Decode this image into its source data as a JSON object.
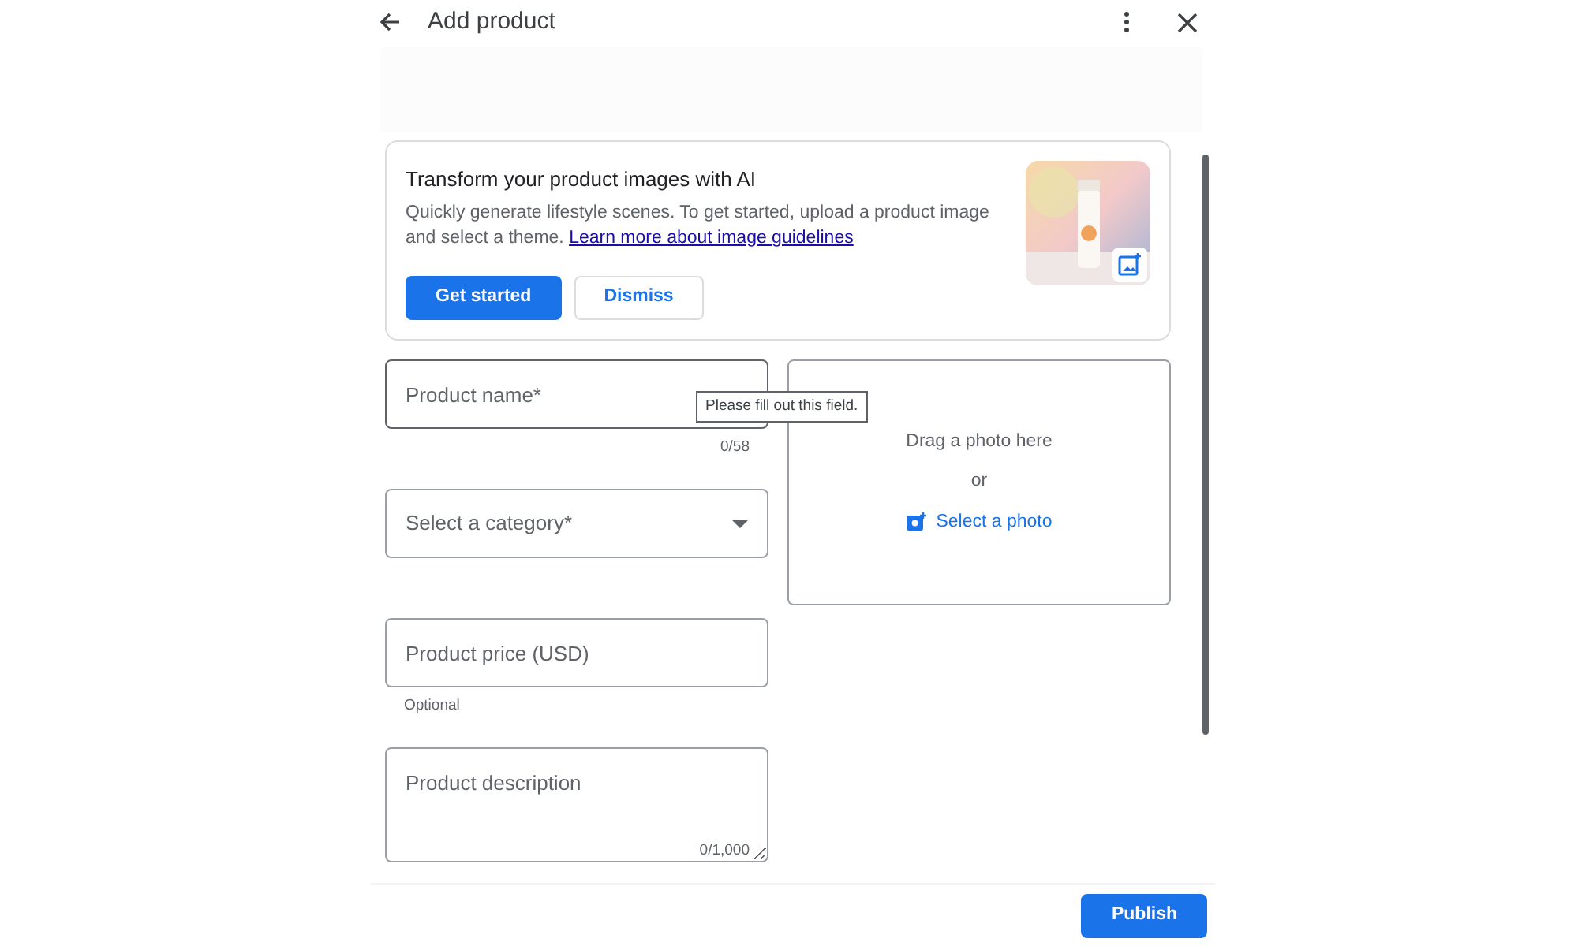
{
  "header": {
    "title": "Add product"
  },
  "banner": {
    "title": "Transform your product images with AI",
    "text": "Quickly generate lifestyle scenes. To get started, upload a product image and select a theme.",
    "link": "Learn more about image guidelines",
    "buttons": [
      {
        "label": "Get started",
        "kind": "primary"
      },
      {
        "label": "Dismiss",
        "kind": "secondary"
      }
    ]
  },
  "fields": [
    {
      "kind": "text",
      "placeholder": "Product name*",
      "focused": true,
      "counter": "0/58",
      "tooltip": "Please fill out this field."
    },
    {
      "kind": "select",
      "placeholder": "Select a category*",
      "focused": false
    },
    {
      "kind": "text",
      "placeholder": "Product price (USD)",
      "focused": false,
      "helper": "Optional"
    },
    {
      "kind": "textarea",
      "placeholder": "Product description",
      "focused": false,
      "counter": "0/1,000"
    }
  ],
  "dropzone": {
    "text": "Drag a photo here",
    "separator": "or",
    "link": "Select a photo"
  },
  "footer": {
    "button": "Publish"
  }
}
